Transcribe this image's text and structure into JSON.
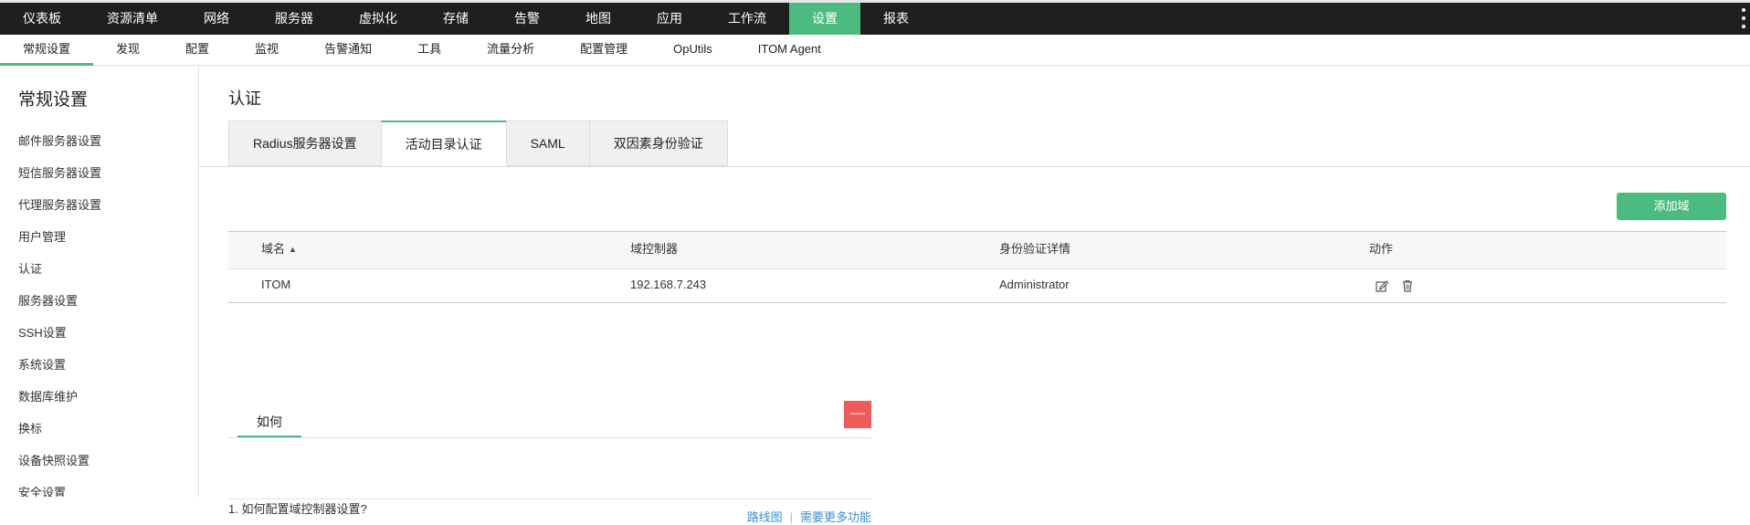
{
  "topnav": {
    "items": [
      "仪表板",
      "资源清单",
      "网络",
      "服务器",
      "虚拟化",
      "存储",
      "告警",
      "地图",
      "应用",
      "工作流",
      "设置",
      "报表"
    ],
    "active_index": 10
  },
  "subnav": {
    "items": [
      "常规设置",
      "发现",
      "配置",
      "监视",
      "告警通知",
      "工具",
      "流量分析",
      "配置管理",
      "OpUtils",
      "ITOM Agent"
    ],
    "active_index": 0
  },
  "sidebar": {
    "title": "常规设置",
    "items": [
      "邮件服务器设置",
      "短信服务器设置",
      "代理服务器设置",
      "用户管理",
      "认证",
      "服务器设置",
      "SSH设置",
      "系统设置",
      "数据库维护",
      "换标",
      "设备快照设置",
      "安全设置"
    ]
  },
  "main": {
    "title": "认证",
    "tabs": [
      "Radius服务器设置",
      "活动目录认证",
      "SAML",
      "双因素身份验证"
    ],
    "active_tab": 1,
    "add_button": "添加域",
    "table": {
      "headers": [
        "域名",
        "域控制器",
        "身份验证详情",
        "动作"
      ],
      "rows": [
        [
          "ITOM",
          "192.168.7.243",
          "Administrator"
        ]
      ]
    },
    "howto": {
      "tab": "如何",
      "collapse": "—",
      "question": "1. 如何配置域控制器设置?",
      "links": [
        "路线图",
        "需要更多功能"
      ],
      "separator": "|"
    }
  },
  "colors": {
    "accent": "#4cbb7f",
    "topbar": "#1f1f1f",
    "collapse": "#f05a5a",
    "link": "#3b8fd0"
  },
  "icons": {
    "sort": "sort-asc-icon",
    "edit": "edit-icon",
    "delete": "trash-icon",
    "more": "kebab-menu-icon"
  }
}
